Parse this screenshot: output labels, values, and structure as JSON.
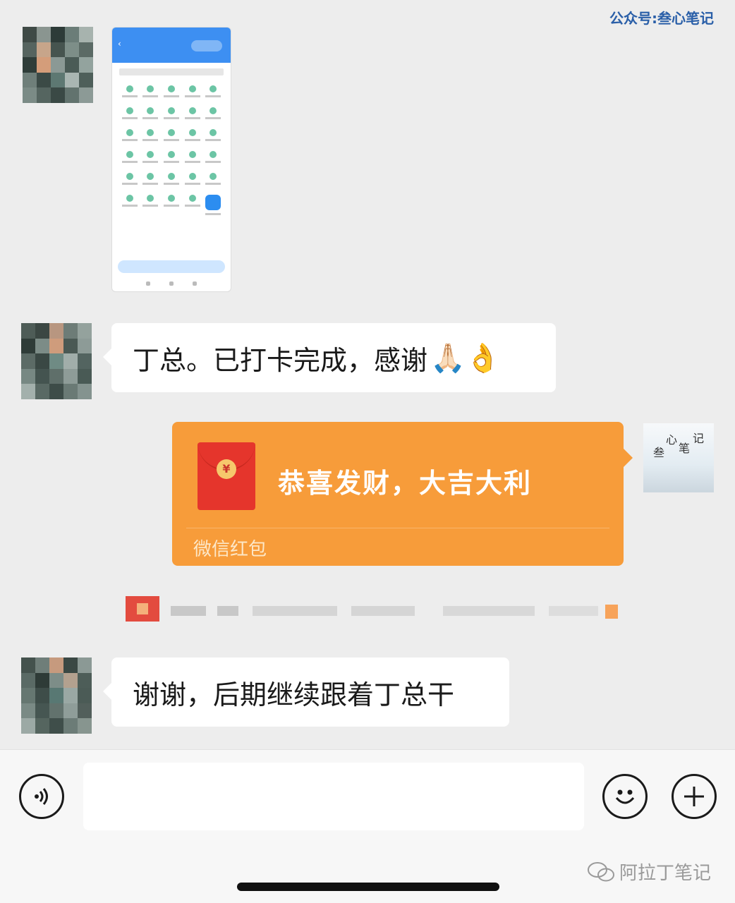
{
  "watermark_top": "公众号:叁心笔记",
  "messages": [
    {
      "text": "丁总。已打卡完成，感谢",
      "emojis": "🙏🏻👌"
    },
    {
      "text": "谢谢，后期继续跟着丁总干"
    }
  ],
  "red_packet": {
    "coin_symbol": "¥",
    "greeting": "恭喜发财，大吉大利",
    "footer": "微信红包"
  },
  "my_avatar": {
    "calligraphy": [
      "叁",
      "心",
      "笔",
      "记"
    ]
  },
  "bottom_watermark": "阿拉丁笔记",
  "icons": {
    "voice": "voice-icon",
    "emoji": "smiley-icon",
    "add": "plus-icon",
    "wechat": "wechat-logo-icon"
  },
  "colors": {
    "background": "#ededed",
    "red_packet": "#f79c3a",
    "red_packet_icon": "#e5352c"
  }
}
